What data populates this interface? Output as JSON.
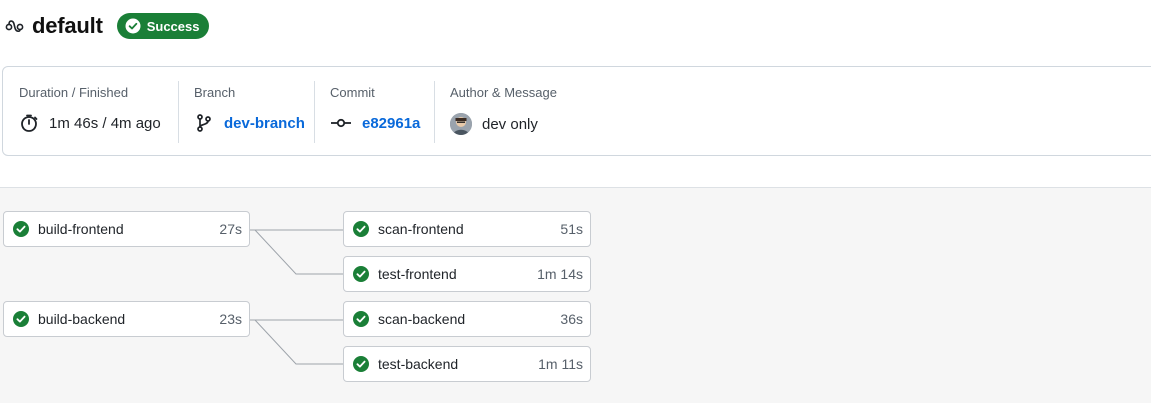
{
  "workflow": {
    "icon": "workflow-icon",
    "title": "default",
    "status": "Success",
    "status_icon": "check-circle-icon",
    "status_color": "#1a7f37"
  },
  "summary": {
    "duration": {
      "label": "Duration / Finished",
      "value": "1m 46s / 4m ago",
      "icon": "timer-icon"
    },
    "branch": {
      "label": "Branch",
      "value": "dev-branch",
      "icon": "git-branch-icon"
    },
    "commit": {
      "label": "Commit",
      "value": "e82961a",
      "icon": "git-commit-icon"
    },
    "author": {
      "label": "Author & Message",
      "message": "dev only",
      "icon": "avatar"
    }
  },
  "jobs": [
    {
      "name": "build-frontend",
      "duration": "27s",
      "status": "success"
    },
    {
      "name": "scan-frontend",
      "duration": "51s",
      "status": "success"
    },
    {
      "name": "test-frontend",
      "duration": "1m 14s",
      "status": "success"
    },
    {
      "name": "build-backend",
      "duration": "23s",
      "status": "success"
    },
    {
      "name": "scan-backend",
      "duration": "36s",
      "status": "success"
    },
    {
      "name": "test-backend",
      "duration": "1m 11s",
      "status": "success"
    }
  ]
}
